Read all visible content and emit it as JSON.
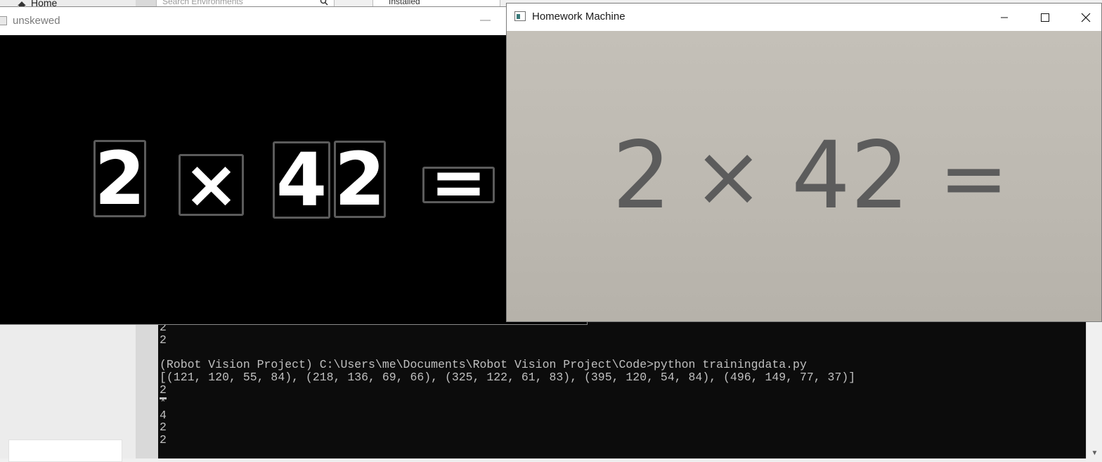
{
  "background_app": {
    "home_label": "Home",
    "search_placeholder": "Search Environments",
    "filter_label": "Installed"
  },
  "console": {
    "lines": [
      "2",
      "2",
      "",
      "(Robot Vision Project) C:\\Users\\me\\Documents\\Robot Vision Project\\Code>python trainingdata.py",
      "[(121, 120, 55, 84), (218, 136, 69, 66), (325, 122, 61, 83), (395, 120, 54, 84), (496, 149, 77, 37)]",
      "2",
      "*",
      "4",
      "2",
      "2"
    ],
    "background": "#0c0c0c",
    "foreground": "#c0c0c0"
  },
  "window_unskewed": {
    "title": "unskewed",
    "minimize_glyph": "—",
    "digits": [
      "2",
      "×",
      "4",
      "2",
      "="
    ]
  },
  "window_homework": {
    "title": "Homework Machine",
    "photo_text": {
      "d1": "2",
      "op": "×",
      "d2": "42",
      "eq": "="
    }
  }
}
